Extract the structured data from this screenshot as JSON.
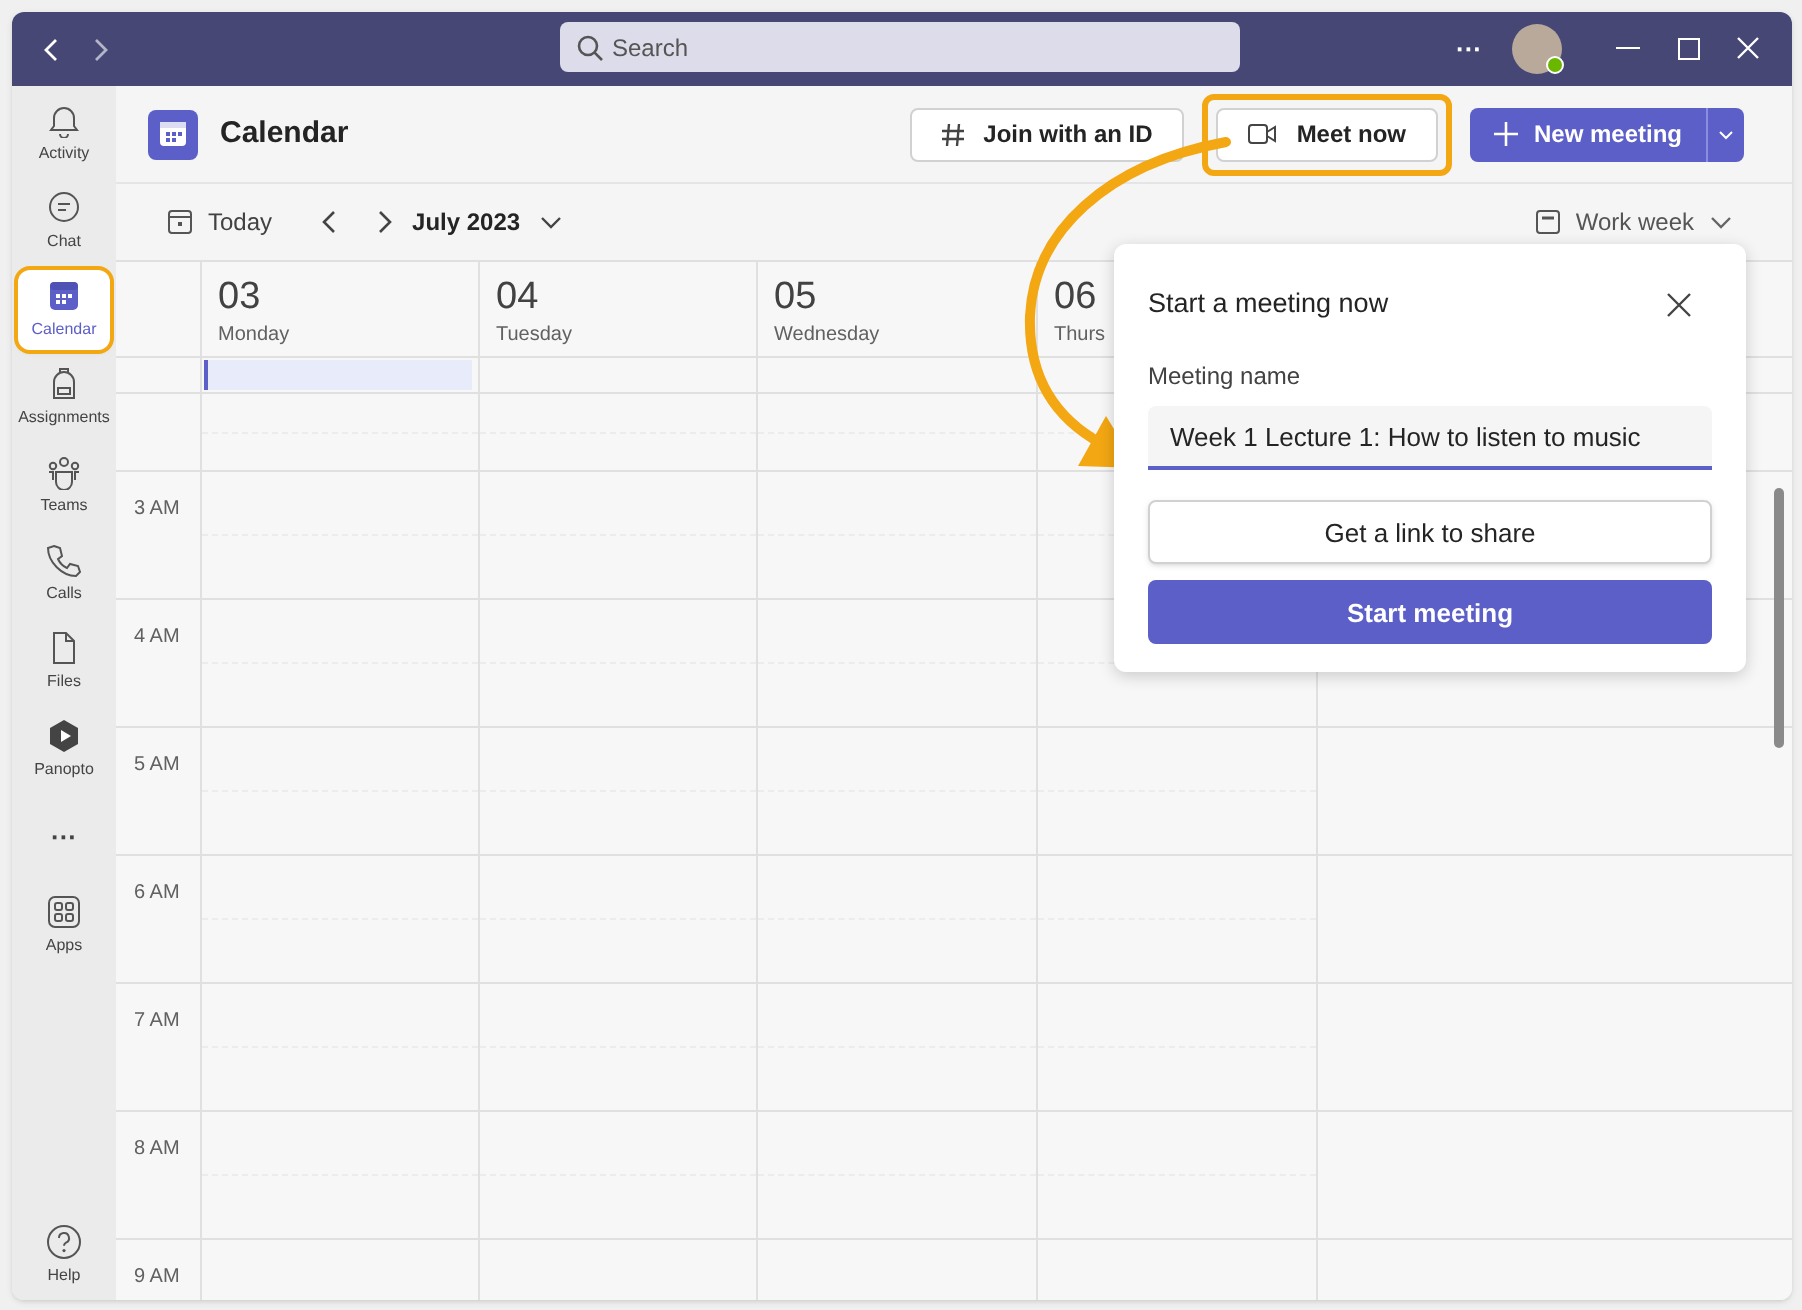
{
  "title_bar": {
    "search": {
      "placeholder": "Search"
    },
    "more": "···"
  },
  "rail": [
    {
      "label": "Activity",
      "kind": "app",
      "selected": false
    },
    {
      "label": "Chat",
      "kind": "app",
      "selected": false
    },
    {
      "label": "Calendar",
      "kind": "app",
      "selected": true
    },
    {
      "label": "Assignments",
      "kind": "app",
      "selected": false
    },
    {
      "label": "Teams",
      "kind": "app",
      "selected": false
    },
    {
      "label": "Calls",
      "kind": "app",
      "selected": false
    },
    {
      "label": "Files",
      "kind": "app",
      "selected": false
    },
    {
      "label": "Panopto",
      "kind": "app",
      "selected": false
    },
    {
      "label": "···",
      "kind": "more",
      "selected": false
    },
    {
      "label": "Apps",
      "kind": "app",
      "selected": false
    }
  ],
  "rail_help": {
    "label": "Help"
  },
  "header": {
    "title": "Calendar",
    "buttons": [
      {
        "label": "Join with an ID",
        "kind": "hash",
        "highlighted": false
      },
      {
        "label": "Meet now",
        "kind": "video",
        "highlighted": true
      },
      {
        "label": "New meeting",
        "kind": "primary",
        "highlighted": false
      }
    ]
  },
  "toolbar": {
    "today": "Today",
    "month": "July 2023",
    "view": "Work week"
  },
  "days": [
    {
      "number": "03",
      "weekday": "Monday"
    },
    {
      "number": "04",
      "weekday": "Tuesday"
    },
    {
      "number": "05",
      "weekday": "Wednesday"
    },
    {
      "number": "06",
      "weekday": "Thurs"
    }
  ],
  "hours": [
    "3 AM",
    "4 AM",
    "5 AM",
    "6 AM",
    "7 AM",
    "8 AM",
    "9 AM"
  ],
  "dialog": {
    "title": "Start a meeting now",
    "field_label": "Meeting name",
    "field_value": "Week 1 Lecture 1: How to listen to music",
    "secondary": "Get a link to share",
    "primary": "Start meeting"
  }
}
